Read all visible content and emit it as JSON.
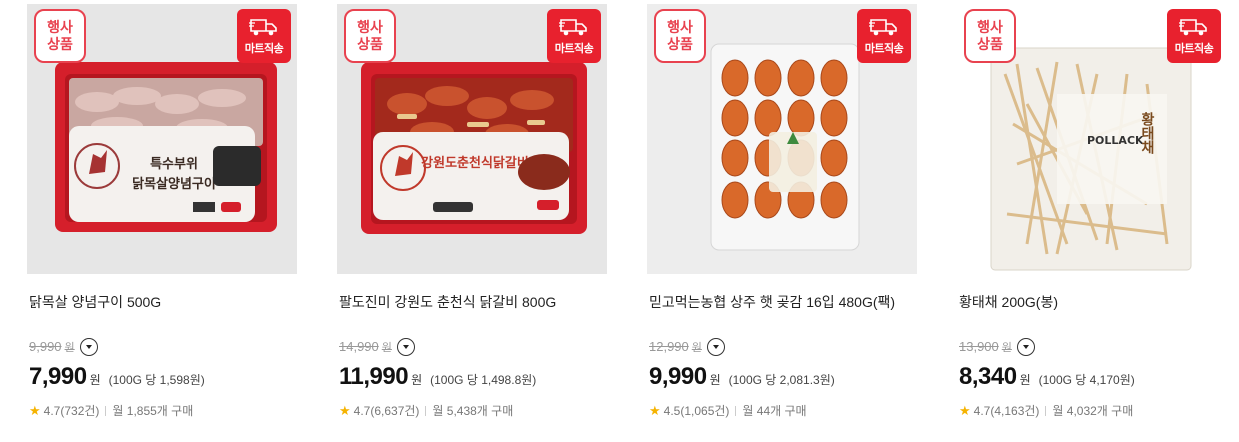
{
  "badges": {
    "event_line1": "행사",
    "event_line2": "상품",
    "direct": "마트직송"
  },
  "colors": {
    "accent": "#e8212e",
    "star": "#f5b301"
  },
  "products": [
    {
      "name": "닭목살 양념구이 500G",
      "orig_price": "9,990",
      "won": "원",
      "price": "7,990",
      "unit_price": "(100G 당 1,598원)",
      "rating": "4.7",
      "reviews": "(732건)",
      "monthly": "월 1,855개 구매",
      "package_line1": "특수부위",
      "package_line2": "닭목살양념구이"
    },
    {
      "name": "팔도진미 강원도 춘천식 닭갈비 800G",
      "orig_price": "14,990",
      "won": "원",
      "price": "11,990",
      "unit_price": "(100G 당 1,498.8원)",
      "rating": "4.7",
      "reviews": "(6,637건)",
      "monthly": "월 5,438개 구매",
      "package_line1": "강원도춘천식닭갈비"
    },
    {
      "name": "믿고먹는농협 상주 햇 곶감 16입 480G(팩)",
      "orig_price": "12,990",
      "won": "원",
      "price": "9,990",
      "unit_price": "(100G 당 2,081.3원)",
      "rating": "4.5",
      "reviews": "(1,065건)",
      "monthly": "월 44개 구매"
    },
    {
      "name": "황태채 200G(봉)",
      "orig_price": "13,900",
      "won": "원",
      "price": "8,340",
      "unit_price": "(100G 당 4,170원)",
      "rating": "4.7",
      "reviews": "(4,163건)",
      "monthly": "월 4,032개 구매",
      "package_line1": "황태채",
      "package_line2": "POLLACK"
    }
  ]
}
